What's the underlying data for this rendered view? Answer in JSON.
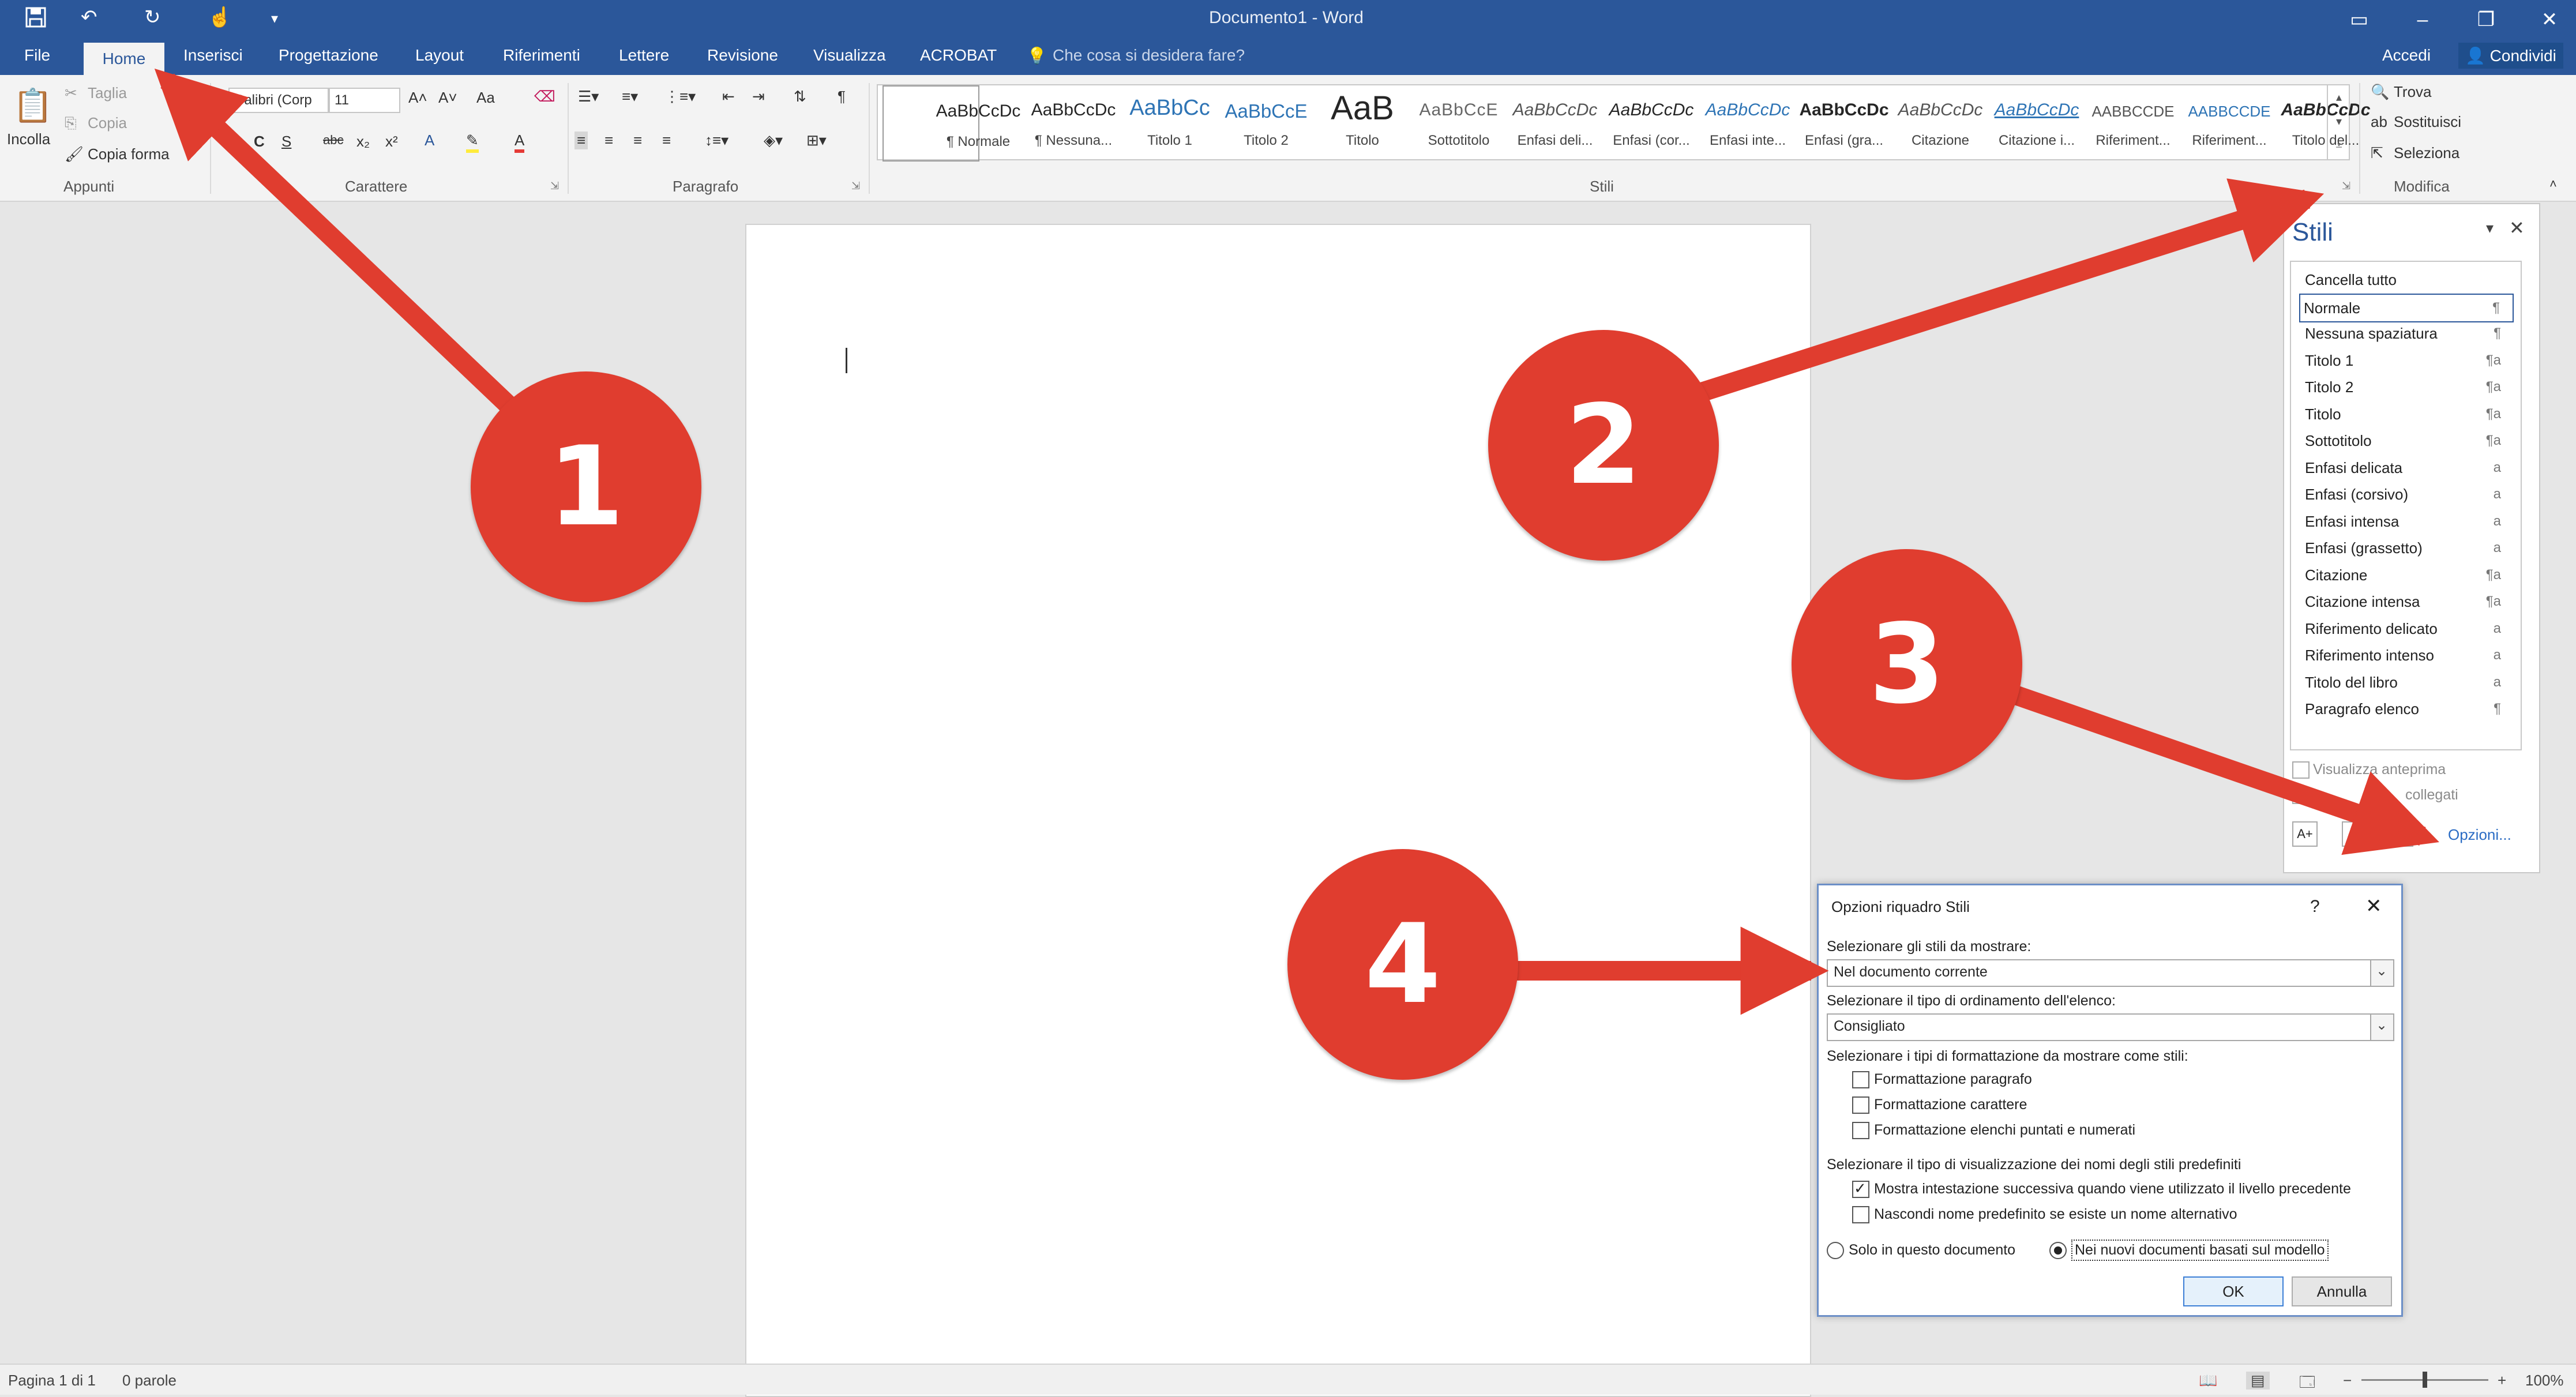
{
  "window": {
    "title": "Documento1 - Word"
  },
  "tabs": [
    "File",
    "Home",
    "Inserisci",
    "Progettazione",
    "Layout",
    "Riferimenti",
    "Lettere",
    "Revisione",
    "Visualizza",
    "ACROBAT"
  ],
  "tell_me": "Che cosa si desidera fare?",
  "account": {
    "signin": "Accedi",
    "share": "Condividi"
  },
  "clipboard": {
    "paste": "Incolla",
    "cut": "Taglia",
    "copy": "Copia",
    "format_painter": "Copia forma",
    "group": "Appunti"
  },
  "font": {
    "name": "Calibri (Corp",
    "size": "11",
    "case": "Aa",
    "group": "Carattere"
  },
  "paragraph": {
    "group": "Paragrafo"
  },
  "styles_gallery": [
    {
      "sample": "AaBbCcDc",
      "name": "¶ Normale"
    },
    {
      "sample": "AaBbCcDc",
      "name": "¶ Nessuna..."
    },
    {
      "sample": "AaBbCc",
      "name": "Titolo 1"
    },
    {
      "sample": "AaBbCcE",
      "name": "Titolo 2"
    },
    {
      "sample": "AaB",
      "name": "Titolo"
    },
    {
      "sample": "AaBbCcE",
      "name": "Sottotitolo"
    },
    {
      "sample": "AaBbCcDc",
      "name": "Enfasi deli..."
    },
    {
      "sample": "AaBbCcDc",
      "name": "Enfasi (cor..."
    },
    {
      "sample": "AaBbCcDc",
      "name": "Enfasi inte..."
    },
    {
      "sample": "AaBbCcDc",
      "name": "Enfasi (gra..."
    },
    {
      "sample": "AaBbCcDc",
      "name": "Citazione"
    },
    {
      "sample": "AaBbCcDc",
      "name": "Citazione i..."
    },
    {
      "sample": "AABBCCDE",
      "name": "Riferiment..."
    },
    {
      "sample": "AABBCCDE",
      "name": "Riferiment..."
    },
    {
      "sample": "AaBbCcDc",
      "name": "Titolo del..."
    }
  ],
  "styles_group": "Stili",
  "edit": {
    "find": "Trova",
    "replace": "Sostituisci",
    "select": "Seleziona",
    "group": "Modifica"
  },
  "styles_pane": {
    "title": "Stili",
    "items": [
      {
        "label": "Cancella tutto",
        "mark": ""
      },
      {
        "label": "Normale",
        "mark": "¶"
      },
      {
        "label": "Nessuna spaziatura",
        "mark": "¶"
      },
      {
        "label": "Titolo 1",
        "mark": "¶a"
      },
      {
        "label": "Titolo 2",
        "mark": "¶a"
      },
      {
        "label": "Titolo",
        "mark": "¶a"
      },
      {
        "label": "Sottotitolo",
        "mark": "¶a"
      },
      {
        "label": "Enfasi delicata",
        "mark": "a"
      },
      {
        "label": "Enfasi (corsivo)",
        "mark": "a"
      },
      {
        "label": "Enfasi intensa",
        "mark": "a"
      },
      {
        "label": "Enfasi (grassetto)",
        "mark": "a"
      },
      {
        "label": "Citazione",
        "mark": "¶a"
      },
      {
        "label": "Citazione intensa",
        "mark": "¶a"
      },
      {
        "label": "Riferimento delicato",
        "mark": "a"
      },
      {
        "label": "Riferimento intenso",
        "mark": "a"
      },
      {
        "label": "Titolo del libro",
        "mark": "a"
      },
      {
        "label": "Paragrafo elenco",
        "mark": "¶"
      }
    ],
    "show_preview": "Visualizza anteprima",
    "linked": "collegati",
    "options_link": "Opzioni..."
  },
  "dialog": {
    "title": "Opzioni riquadro Stili",
    "help": "?",
    "select_styles_label": "Selezionare gli stili da mostrare:",
    "select_styles_value": "Nel documento corrente",
    "sort_label": "Selezionare il tipo di ordinamento dell'elenco:",
    "sort_value": "Consigliato",
    "format_types_label": "Selezionare i tipi di formattazione da mostrare come stili:",
    "format_options": [
      "Formattazione paragrafo",
      "Formattazione carattere",
      "Formattazione elenchi puntati e numerati"
    ],
    "display_label": "Selezionare il tipo di visualizzazione dei nomi degli stili predefiniti",
    "display_options": [
      {
        "label": "Mostra intestazione successiva quando viene utilizzato il livello precedente",
        "checked": true
      },
      {
        "label": "Nascondi nome predefinito se esiste un nome alternativo",
        "checked": false
      }
    ],
    "radio_this_doc": "Solo in questo documento",
    "radio_new_docs": "Nei nuovi documenti basati sul modello",
    "ok": "OK",
    "cancel": "Annulla"
  },
  "status": {
    "page": "Pagina 1 di 1",
    "words": "0 parole",
    "zoom": "100%"
  },
  "callouts": [
    "1",
    "2",
    "3",
    "4"
  ],
  "colors": {
    "word_blue": "#2b579a",
    "callout_red": "#e03d2f"
  }
}
